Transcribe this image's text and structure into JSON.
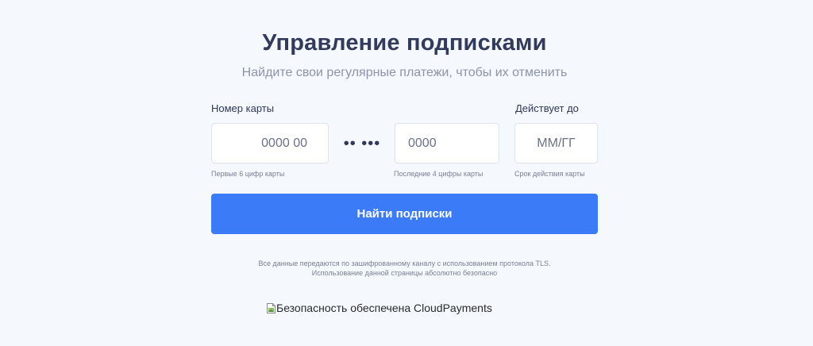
{
  "header": {
    "title": "Управление подписками",
    "subtitle": "Найдите свои регулярные платежи, чтобы их отменить"
  },
  "form": {
    "card_number_label": "Номер карты",
    "valid_label": "Действует до",
    "first_digits": {
      "value": "",
      "placeholder": "0000 00",
      "hint": "Первые 6 цифр карты"
    },
    "mask_dots": "•• •••",
    "last_digits": {
      "value": "",
      "placeholder": "0000",
      "hint": "Последние 4 цифры карты"
    },
    "expiry": {
      "value": "",
      "placeholder": "ММ/ГГ",
      "hint": "Срок действия карты"
    },
    "submit_label": "Найти подписки"
  },
  "footer": {
    "notice_line1": "Все данные передаются по зашифрованному каналу с использованием протокола TLS.",
    "notice_line2": "Использование данной страницы абсолютно безопасно",
    "secured_by": "Безопасность обеспечена CloudPayments",
    "secured_icon": "broken-image-icon"
  },
  "colors": {
    "background": "#f5f8fd",
    "accent": "#3b7bf7",
    "title": "#323b5c",
    "muted": "#8d93a8"
  }
}
